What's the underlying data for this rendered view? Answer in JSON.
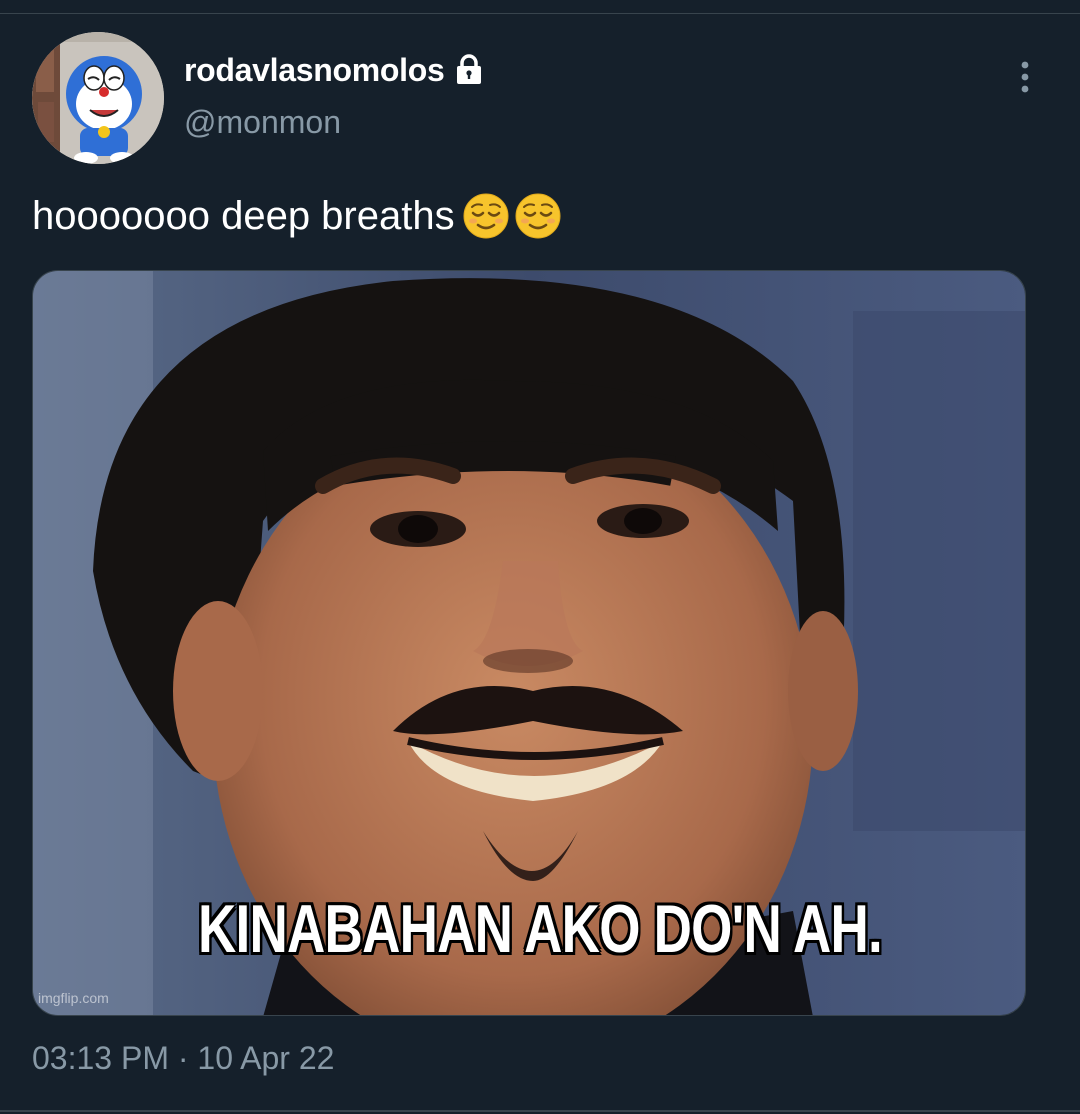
{
  "tweet": {
    "display_name": "rodavlasnomolos",
    "handle": "@monmon",
    "text": "hooooooo deep breaths",
    "emojis": [
      "relieved-face-emoji",
      "relieved-face-emoji"
    ],
    "timestamp": "03:13 PM · 10 Apr 22"
  },
  "media": {
    "caption": "KINABAHAN AKO DO'N AH.",
    "watermark": "imgflip.com"
  },
  "icons": {
    "lock": "lock-icon",
    "more": "more-vertical-icon"
  },
  "colors": {
    "background": "#15202b",
    "secondary_text": "#8899a6",
    "primary_text": "#ffffff",
    "border": "#38444d"
  }
}
